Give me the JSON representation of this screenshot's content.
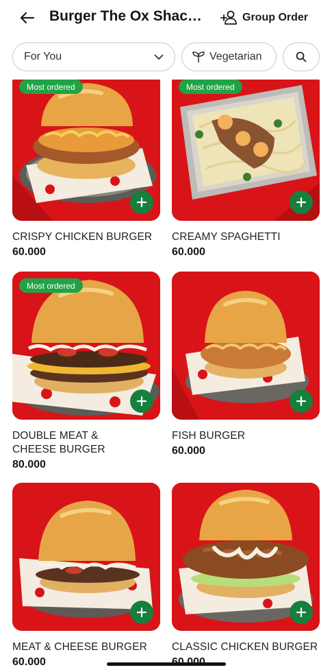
{
  "header": {
    "title": "Burger The Ox Shack...",
    "group_order_label": "Group Order"
  },
  "filters": {
    "category_selected": "For You",
    "vegetarian_label": "Vegetarian"
  },
  "colors": {
    "badge_green": "#21a246",
    "add_button_green": "#15803d",
    "photo_background_red": "#d81418"
  },
  "menu": {
    "badge_label": "Most ordered",
    "items": [
      {
        "name": "CRISPY CHICKEN BURGER",
        "price": "60.000",
        "badge": "Most ordered"
      },
      {
        "name": "CREAMY SPAGHETTI",
        "price": "60.000",
        "badge": "Most ordered"
      },
      {
        "name": "DOUBLE MEAT & CHEESE BURGER",
        "price": "80.000",
        "badge": "Most ordered"
      },
      {
        "name": "FISH BURGER",
        "price": "60.000"
      },
      {
        "name": "MEAT & CHEESE BURGER",
        "price": "60.000"
      },
      {
        "name": "CLASSIC CHICKEN BURGER",
        "price": "60.000"
      }
    ]
  },
  "icons": {
    "back": "arrow-left-icon",
    "group_order": "add-people-icon",
    "dropdown": "chevron-down-icon",
    "vegetarian": "leaf-icon",
    "search": "search-icon",
    "add": "plus-icon"
  }
}
